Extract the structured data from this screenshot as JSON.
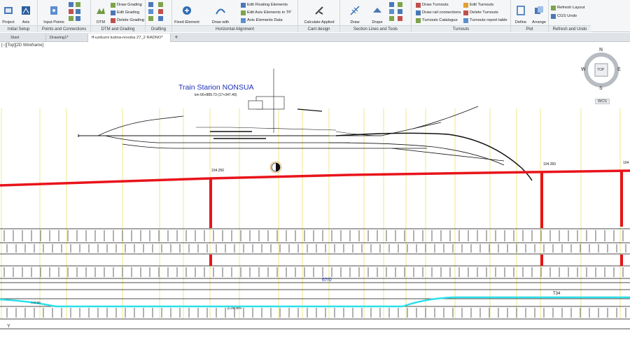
{
  "ribbon": {
    "panels": [
      {
        "title": "Initial Setup",
        "buttons": [
          "Project",
          "Axis\nManager"
        ]
      },
      {
        "title": "Points and Connections",
        "buttons": [
          "Input Points\nfrom File"
        ]
      },
      {
        "title": "DTM and Grading",
        "buttons": [
          "DTM"
        ],
        "small": [
          "Draw Grading",
          "Edit Grading",
          "Delete Grading"
        ]
      },
      {
        "title": "Drafting"
      },
      {
        "title": "Horizontal Alignment",
        "buttons": [
          "Fixed Element\nArc",
          "Draw with\nFloating Elements"
        ],
        "small": [
          "Edit Floating Elements",
          "Edit Axis Elements in TP",
          "Axis Elements Data"
        ]
      },
      {
        "title": "Cant design",
        "buttons": [
          "Calculate Applied\nCant"
        ]
      },
      {
        "title": "Section Lines and Tools",
        "buttons": [
          "Draw\nSection Lines",
          "Drape"
        ]
      },
      {
        "title": "Turnouts",
        "small": [
          "Draw Turnouts",
          "Draw rail connections",
          "Turnouts Catalogue",
          "Edit Turnouts",
          "Delete Turnouts",
          "Turnouts report table"
        ]
      },
      {
        "title": "Plot",
        "buttons": [
          "Define\nPlot Area",
          "Arrange\nto Paper"
        ]
      },
      {
        "title": "Refresh and Undo",
        "small": [
          "Refresh Layout",
          "CGS Undo"
        ]
      }
    ]
  },
  "tabs": [
    "Start",
    "Drawing1*",
    "ff-uzduzni kutina-novska 27_2 RADNO*"
  ],
  "viewport_label": "[−][Top][2D Wireframe]",
  "viewcube": {
    "n": "N",
    "s": "S",
    "e": "E",
    "w": "W",
    "top": "TOP",
    "wcs": "WCS"
  },
  "drawing": {
    "station_title": "Train Starion NONSUA",
    "station_sub": "km 66+889.73 (17+347.40)",
    "elev_left": "104.250",
    "elev_right": "104.350",
    "elev_far": "104",
    "bottom_label": "67/0",
    "t_label": "T34",
    "curve_label_left": "I=0.00",
    "curve_label_mid": "p=28.30%",
    "axis_y": "Y"
  },
  "colors": {
    "profile_red": "#e8141b",
    "grid_yellow": "#ede87a",
    "cyan": "#2fe0e8",
    "title_blue": "#1a2fb8"
  }
}
